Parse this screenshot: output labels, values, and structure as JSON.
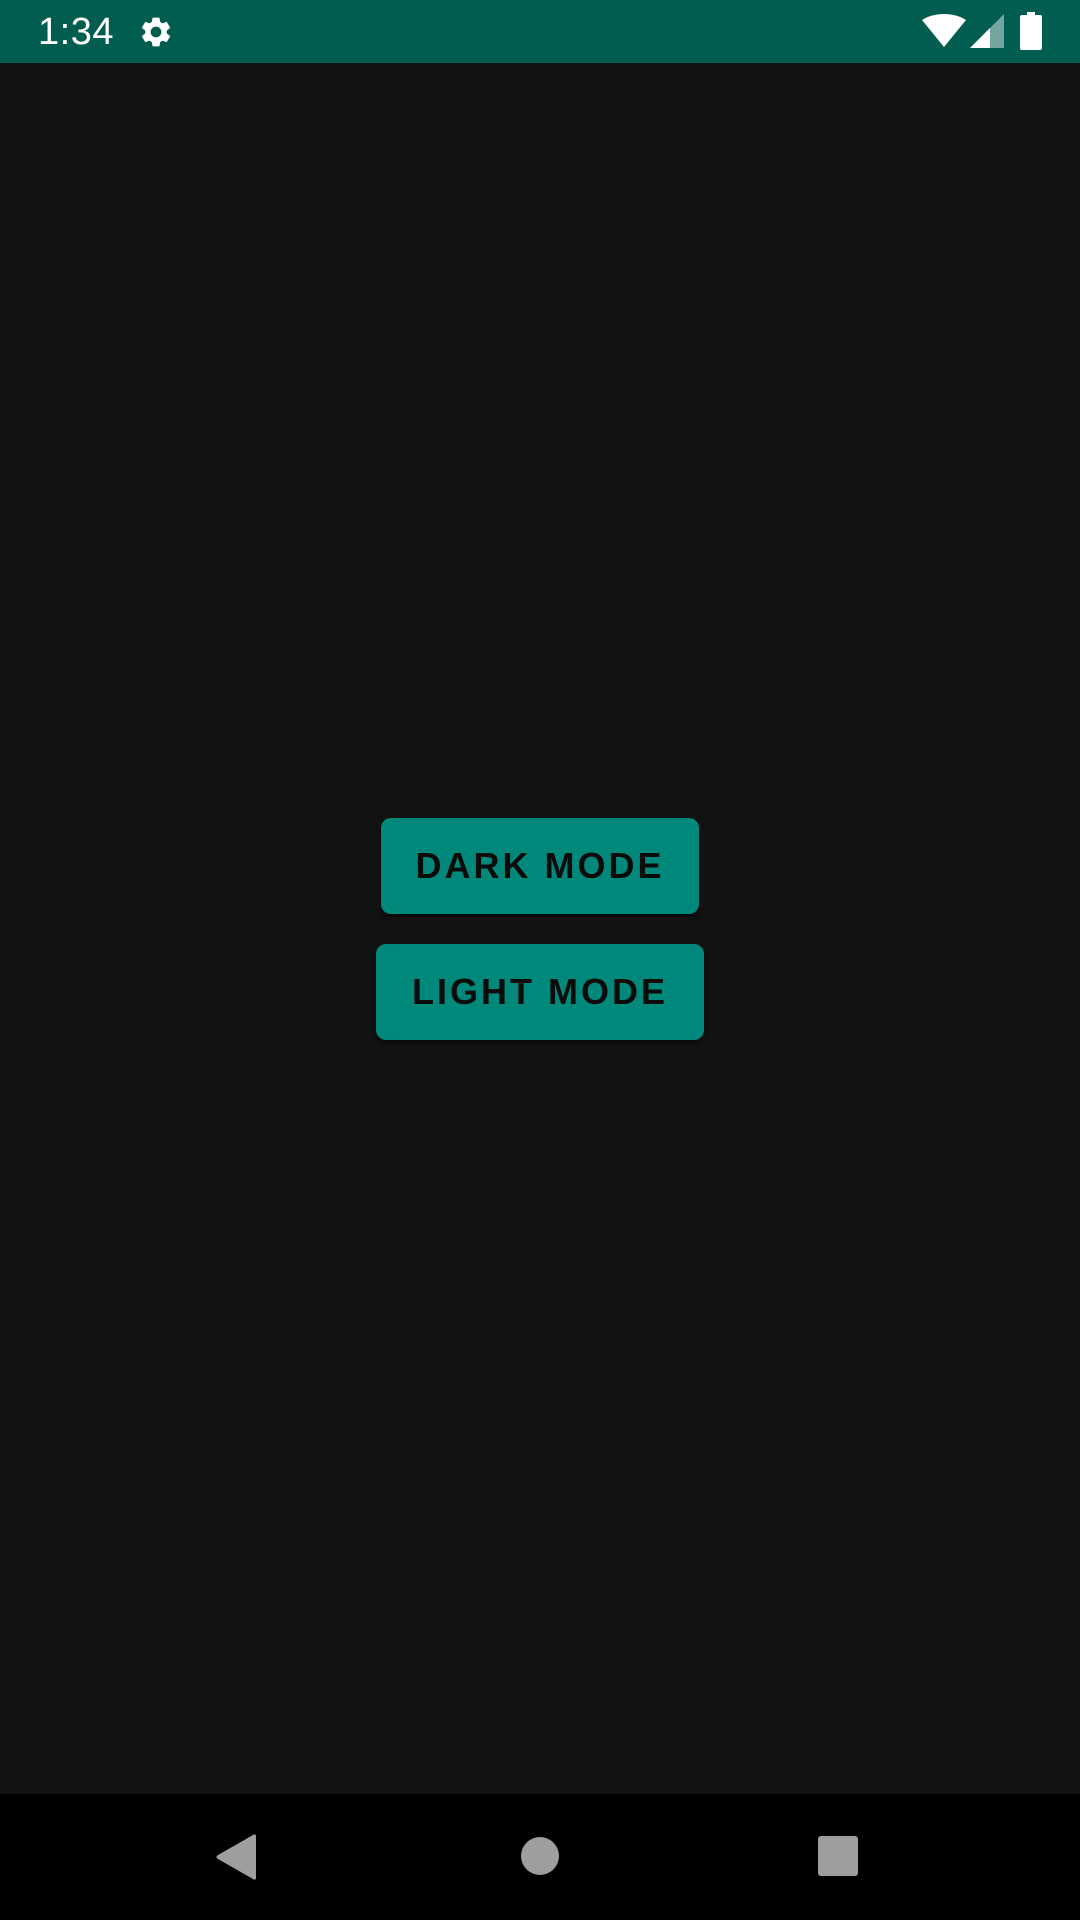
{
  "status_bar": {
    "time": "1:34",
    "icons": [
      "gear-icon",
      "wifi-icon",
      "signal-icon",
      "battery-icon"
    ],
    "background_color": "#005d50"
  },
  "main": {
    "background_color": "#121212",
    "buttons": {
      "dark_mode_label": "DARK MODE",
      "light_mode_label": "LIGHT MODE"
    },
    "button_color": "#00897b"
  },
  "nav_bar": {
    "icons": [
      "back-icon",
      "home-icon",
      "recents-icon"
    ]
  }
}
